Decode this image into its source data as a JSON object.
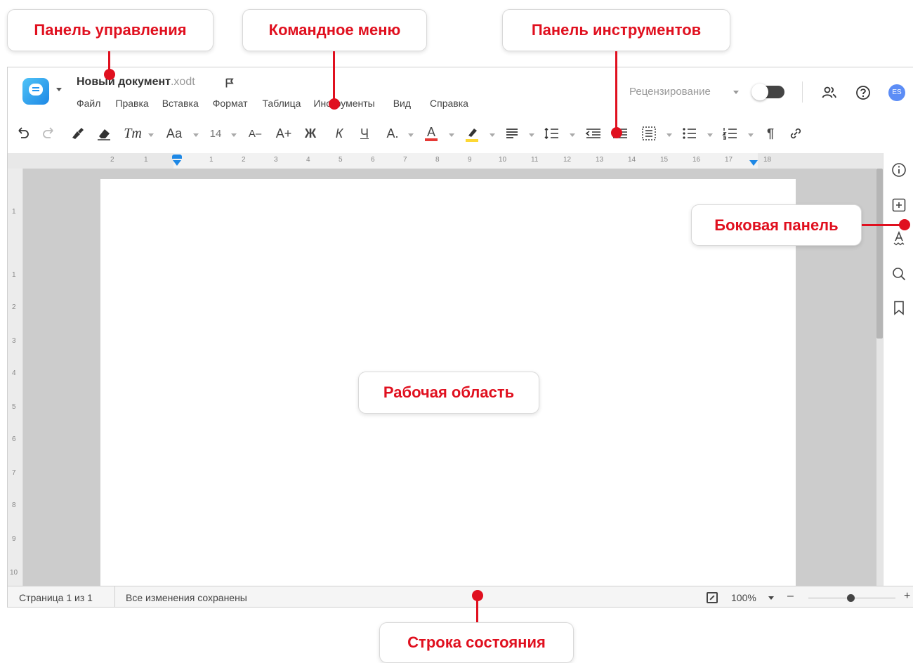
{
  "header": {
    "doc_name": "Новый документ",
    "doc_ext": ".xodt",
    "menu": [
      "Файл",
      "Правка",
      "Вставка",
      "Формат",
      "Таблица",
      "Инструменты",
      "Вид",
      "Справка"
    ],
    "review_label": "Рецензирование",
    "avatar_initials": "ES"
  },
  "toolbar": {
    "text_style": "Тт",
    "font_case": "Аа",
    "font_size": "14",
    "decrease_font": "А–",
    "increase_font": "А+",
    "bold": "Ж",
    "italic": "К",
    "underline": "Ч",
    "strike": "А.",
    "font_color": "А",
    "paragraph_mark": "¶"
  },
  "ruler": {
    "numbers": [
      "2",
      "1",
      "1",
      "2",
      "3",
      "4",
      "5",
      "6",
      "7",
      "8",
      "9",
      "10",
      "11",
      "12",
      "13",
      "14",
      "15",
      "16",
      "17",
      "18"
    ],
    "vertical_numbers": [
      "1",
      "1",
      "2",
      "3",
      "4",
      "5",
      "6",
      "7",
      "8",
      "9",
      "10"
    ]
  },
  "statusbar": {
    "page_info": "Страница 1 из 1",
    "save_status": "Все изменения сохранены",
    "zoom": "100%",
    "zoom_minus": "–",
    "zoom_plus": "+"
  },
  "callouts": {
    "control_panel": "Панель управления",
    "command_menu": "Командное меню",
    "toolbar": "Панель инструментов",
    "sidebar": "Боковая панель",
    "workspace": "Рабочая область",
    "statusbar": "Строка состояния"
  },
  "colors": {
    "accent_red": "#e0101f",
    "logo_blue": "#2196f3",
    "avatar": "#5c8df6",
    "marker_blue": "#1e88e5",
    "font_color_underline": "#e53935",
    "highlight_yellow": "#fdd835"
  }
}
